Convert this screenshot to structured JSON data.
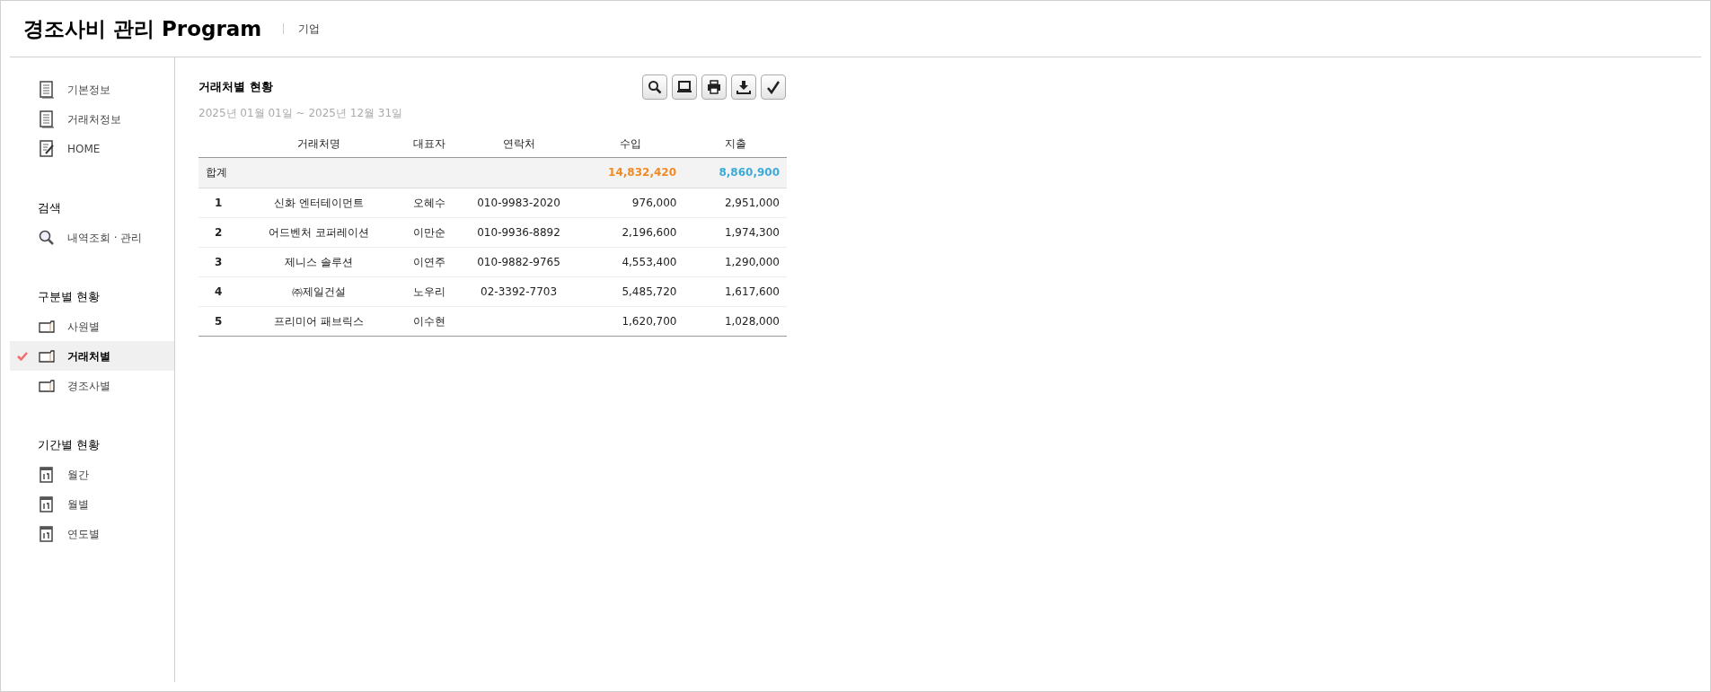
{
  "header": {
    "title": "경조사비 관리 Program",
    "subtitle": "기업"
  },
  "sidebar": {
    "sections": [
      {
        "items": [
          {
            "label": "기본정보",
            "kind": "document",
            "selected": false
          },
          {
            "label": "거래처정보",
            "kind": "document",
            "selected": false
          },
          {
            "label": "HOME",
            "kind": "note",
            "selected": false
          }
        ]
      },
      {
        "heading": "검색",
        "items": [
          {
            "label": "내역조회 · 관리",
            "kind": "search",
            "selected": false
          }
        ]
      },
      {
        "heading": "구분별 현황",
        "items": [
          {
            "label": "사원별",
            "kind": "folder",
            "selected": false
          },
          {
            "label": "거래처별",
            "kind": "folder",
            "selected": true
          },
          {
            "label": "경조사별",
            "kind": "folder",
            "selected": false
          }
        ]
      },
      {
        "heading": "기간별 현황",
        "items": [
          {
            "label": "월간",
            "kind": "calendar",
            "selected": false
          },
          {
            "label": "월별",
            "kind": "calendar",
            "selected": false
          },
          {
            "label": "연도별",
            "kind": "calendar",
            "selected": false
          }
        ]
      }
    ]
  },
  "main": {
    "title": "거래처별 현황",
    "period": "2025년 01월 01일 ~ 2025년 12월 31일",
    "toolbar": [
      {
        "kind": "search"
      },
      {
        "kind": "monitor"
      },
      {
        "kind": "print"
      },
      {
        "kind": "download"
      },
      {
        "kind": "check"
      }
    ],
    "table": {
      "columns": [
        "거래처명",
        "대표자",
        "연락처",
        "수입",
        "지출"
      ],
      "total": {
        "label": "합계",
        "income": "14,832,420",
        "expense": "8,860,900"
      },
      "rows": [
        {
          "no": "1",
          "name": "신화 엔터테이먼트",
          "rep": "오혜수",
          "contact": "010-9983-2020",
          "income": "976,000",
          "expense": "2,951,000"
        },
        {
          "no": "2",
          "name": "어드벤처 코퍼레이션",
          "rep": "이만순",
          "contact": "010-9936-8892",
          "income": "2,196,600",
          "expense": "1,974,300"
        },
        {
          "no": "3",
          "name": "제니스 솔루션",
          "rep": "이연주",
          "contact": "010-9882-9765",
          "income": "4,553,400",
          "expense": "1,290,000"
        },
        {
          "no": "4",
          "name": "㈜제일건설",
          "rep": "노우리",
          "contact": "02-3392-7703",
          "income": "5,485,720",
          "expense": "1,617,600"
        },
        {
          "no": "5",
          "name": "프리미어 패브릭스",
          "rep": "이수현",
          "income": "1,620,700",
          "expense": "1,028,000"
        }
      ]
    }
  }
}
